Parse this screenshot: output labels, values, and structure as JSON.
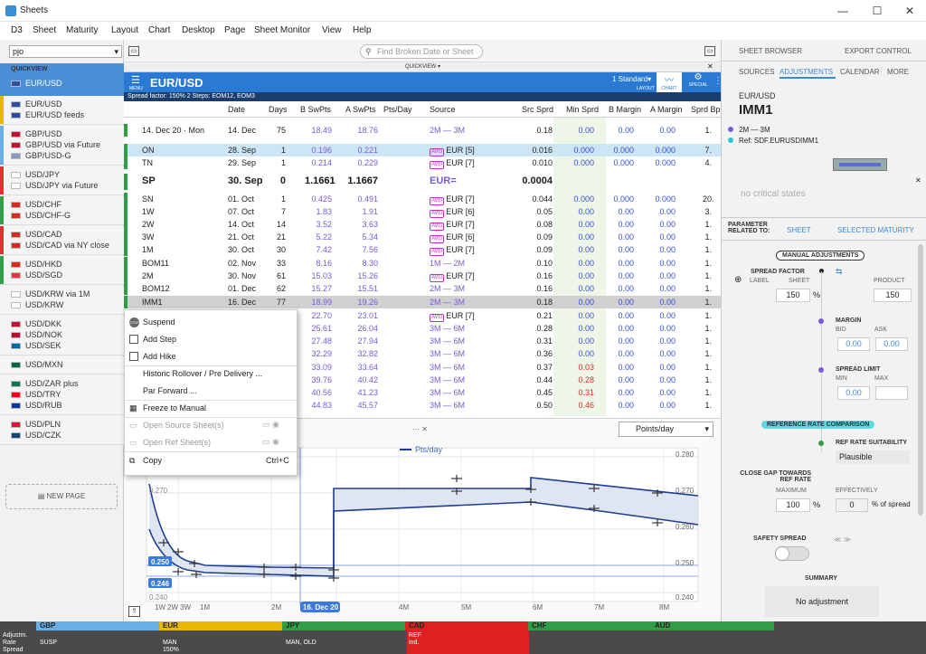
{
  "window": {
    "title": "Sheets"
  },
  "menu": [
    "D3",
    "Sheet",
    "Maturity",
    "Layout",
    "Chart",
    "Desktop",
    "Page",
    "Sheet Monitor",
    "View",
    "Help"
  ],
  "left": {
    "combo": "pjo",
    "quickview": "QUICKVIEW",
    "groups": [
      {
        "color": "#2f9e44",
        "items": [
          "EUR/USD"
        ]
      },
      {
        "color": "#e8b800",
        "items": [
          "EUR/USD",
          "EUR/USD feeds"
        ]
      },
      {
        "color": "#6aaee8",
        "items": [
          "GBP/USD",
          "GBP/USD via Future",
          "GBP/USD-G"
        ]
      },
      {
        "color": "#e03030",
        "items": [
          "USD/JPY",
          "USD/JPY via Future"
        ]
      },
      {
        "color": "#2f9e44",
        "items": [
          "USD/CHF",
          "USD/CHF-G"
        ]
      },
      {
        "color": "#e03030",
        "items": [
          "USD/CAD",
          "USD/CAD via NY close"
        ]
      },
      {
        "color": "#2f9e44",
        "items": [
          "USD/HKD",
          "USD/SGD"
        ]
      },
      {
        "color": "",
        "items": [
          "USD/KRW via 1M",
          "USD/KRW"
        ]
      },
      {
        "color": "",
        "items": [
          "USD/DKK",
          "USD/NOK",
          "USD/SEK"
        ]
      },
      {
        "color": "",
        "items": [
          "USD/MXN"
        ]
      },
      {
        "color": "",
        "items": [
          "USD/ZAR plus",
          "USD/TRY",
          "USD/RUB"
        ]
      },
      {
        "color": "",
        "items": [
          "USD/PLN",
          "USD/CZK"
        ]
      }
    ],
    "new_page": "NEW PAGE"
  },
  "toolbar": {
    "search_placeholder": "Find Broken Date or Sheet",
    "quickview": "QUICKVIEW"
  },
  "sheet": {
    "menu_label": "MENU",
    "title": "EUR/USD",
    "layout": "1 Standard",
    "layout_label": "LAYOUT",
    "chart_label": "CHART",
    "special_label": "SPECIAL",
    "subheader": "Spread factor: 150%   2 Steps: EOM12, EOM3",
    "columns": [
      "Date",
      "Days",
      "B SwPts",
      "A SwPts",
      "Pts/Day",
      "Source",
      "Src Sprd",
      "Min Sprd",
      "B Margin",
      "A Margin",
      "Sprd Bp"
    ],
    "spot_label": "14. Dec 20 · Mon",
    "rows": [
      {
        "name": "",
        "date": "14. Dec",
        "days": "75",
        "b": "18.49",
        "a": "18.76",
        "src": "2M — 3M",
        "sprd": "0.18",
        "min": "0.00",
        "bm": "0.00",
        "am": "0.00",
        "bp": "1."
      },
      {
        "name": "ON",
        "date": "28. Sep",
        "days": "1",
        "b": "0.196",
        "a": "0.221",
        "src": "EUR [5]",
        "sprd": "0.016",
        "min": "0.000",
        "bm": "0.000",
        "am": "0.000",
        "bp": "7."
      },
      {
        "name": "TN",
        "date": "29. Sep",
        "days": "1",
        "b": "0.214",
        "a": "0.229",
        "src": "EUR [7]",
        "sprd": "0.010",
        "min": "0.000",
        "bm": "0.000",
        "am": "0.000",
        "bp": "4."
      },
      {
        "name": "SP",
        "date": "30. Sep",
        "days": "0",
        "b": "1.1661",
        "a": "1.1667",
        "src": "EUR=",
        "sprd": "0.0004",
        "min": "",
        "bm": "",
        "am": "",
        "bp": ""
      },
      {
        "name": "SN",
        "date": "01. Oct",
        "days": "1",
        "b": "0.425",
        "a": "0.491",
        "src": "EUR [7]",
        "sprd": "0.044",
        "min": "0.000",
        "bm": "0.000",
        "am": "0.000",
        "bp": "20."
      },
      {
        "name": "1W",
        "date": "07. Oct",
        "days": "7",
        "b": "1.83",
        "a": "1.91",
        "src": "EUR [6]",
        "sprd": "0.05",
        "min": "0.00",
        "bm": "0.00",
        "am": "0.00",
        "bp": "3."
      },
      {
        "name": "2W",
        "date": "14. Oct",
        "days": "14",
        "b": "3.52",
        "a": "3.63",
        "src": "EUR [7]",
        "sprd": "0.08",
        "min": "0.00",
        "bm": "0.00",
        "am": "0.00",
        "bp": "1."
      },
      {
        "name": "3W",
        "date": "21. Oct",
        "days": "21",
        "b": "5.22",
        "a": "5.34",
        "src": "EUR [6]",
        "sprd": "0.09",
        "min": "0.00",
        "bm": "0.00",
        "am": "0.00",
        "bp": "1."
      },
      {
        "name": "1M",
        "date": "30. Oct",
        "days": "30",
        "b": "7.42",
        "a": "7.56",
        "src": "EUR [7]",
        "sprd": "0.09",
        "min": "0.00",
        "bm": "0.00",
        "am": "0.00",
        "bp": "1."
      },
      {
        "name": "BOM11",
        "date": "02. Nov",
        "days": "33",
        "b": "8.16",
        "a": "8.30",
        "src": "1M — 2M",
        "sprd": "0.10",
        "min": "0.00",
        "bm": "0.00",
        "am": "0.00",
        "bp": "1."
      },
      {
        "name": "2M",
        "date": "30. Nov",
        "days": "61",
        "b": "15.03",
        "a": "15.26",
        "src": "EUR [7]",
        "sprd": "0.16",
        "min": "0.00",
        "bm": "0.00",
        "am": "0.00",
        "bp": "1."
      },
      {
        "name": "BOM12",
        "date": "01. Dec",
        "days": "62",
        "b": "15.27",
        "a": "15.51",
        "src": "2M — 3M",
        "sprd": "0.16",
        "min": "0.00",
        "bm": "0.00",
        "am": "0.00",
        "bp": "1."
      },
      {
        "name": "IMM1",
        "date": "16. Dec",
        "days": "77",
        "b": "18.99",
        "a": "19.26",
        "src": "2M — 3M",
        "sprd": "0.18",
        "min": "0.00",
        "bm": "0.00",
        "am": "0.00",
        "bp": "1."
      },
      {
        "name": "",
        "date": "",
        "days": "",
        "b": "22.70",
        "a": "23.01",
        "src": "EUR [7]",
        "sprd": "0.21",
        "min": "0.00",
        "bm": "0.00",
        "am": "0.00",
        "bp": "1."
      },
      {
        "name": "",
        "date": "",
        "days": "",
        "b": "25.61",
        "a": "26.04",
        "src": "3M — 6M",
        "sprd": "0.28",
        "min": "0.00",
        "bm": "0.00",
        "am": "0.00",
        "bp": "1."
      },
      {
        "name": "",
        "date": "",
        "days": "",
        "b": "27.48",
        "a": "27.94",
        "src": "3M — 6M",
        "sprd": "0.31",
        "min": "0.00",
        "bm": "0.00",
        "am": "0.00",
        "bp": "1."
      },
      {
        "name": "",
        "date": "",
        "days": "",
        "b": "32.29",
        "a": "32.82",
        "src": "3M — 6M",
        "sprd": "0.36",
        "min": "0.00",
        "bm": "0.00",
        "am": "0.00",
        "bp": "1."
      },
      {
        "name": "",
        "date": "",
        "days": "",
        "b": "33.09",
        "a": "33.64",
        "src": "3M — 6M",
        "sprd": "0.37",
        "min": "0.03",
        "bm": "0.00",
        "am": "0.00",
        "bp": "1."
      },
      {
        "name": "",
        "date": "",
        "days": "",
        "b": "39.76",
        "a": "40.42",
        "src": "3M — 6M",
        "sprd": "0.44",
        "min": "0.28",
        "bm": "0.00",
        "am": "0.00",
        "bp": "1."
      },
      {
        "name": "",
        "date": "",
        "days": "",
        "b": "40.56",
        "a": "41.23",
        "src": "3M — 6M",
        "sprd": "0.45",
        "min": "0.31",
        "bm": "0.00",
        "am": "0.00",
        "bp": "1."
      },
      {
        "name": "",
        "date": "",
        "days": "",
        "b": "44.83",
        "a": "45.57",
        "src": "3M — 6M",
        "sprd": "0.50",
        "min": "0.46",
        "bm": "0.00",
        "am": "0.00",
        "bp": "1."
      }
    ]
  },
  "context_menu": [
    "Suspend",
    "Add Step",
    "Add Hike",
    "Historic Rollover / Pre Delivery ...",
    "Par Forward ...",
    "Freeze to Manual",
    "Open Source Sheet(s)",
    "Open Ref Sheet(s)",
    "Copy"
  ],
  "context_shortcut": "Ctrl+C",
  "chart": {
    "dropdown": "Points/day",
    "legend": "Pts/day",
    "y_ticks": [
      "0.280",
      "0.270",
      "0.260",
      "0.250",
      "0.240"
    ],
    "left_ticks": [
      "0.270",
      "0.240"
    ],
    "x_ticks": [
      "1W",
      "2W",
      "3W",
      "1M",
      "2M",
      "4M",
      "5M",
      "6M",
      "7M",
      "8M"
    ],
    "marker_top": "0.250",
    "marker_bottom": "0.246",
    "date_marker": "16. Dec 20"
  },
  "right": {
    "tabs1": [
      "SHEET BROWSER",
      "EXPORT CONTROL"
    ],
    "tabs2": [
      "SOURCES",
      "ADJUSTMENTS",
      "CALENDAR",
      "MORE"
    ],
    "pair": "EUR/USD",
    "maturity": "IMM1",
    "legend1": "2M — 3M",
    "legend2": "Ref: SDF.EURUSDIMM1",
    "no_states": "no critical states",
    "param_label": "PARAMETER RELATED TO:",
    "param_tabs": [
      "SHEET",
      "SELECTED MATURITY"
    ],
    "manual": "MANUAL ADJUSTMENTS",
    "spread_factor": "SPREAD FACTOR",
    "label": "LABEL",
    "sheet": "SHEET",
    "sf_value": "150",
    "product": "PRODUCT",
    "product_value": "150",
    "margin": "MARGIN",
    "bid": "BID",
    "ask": "ASK",
    "bid_value": "0.00",
    "ask_value": "0.00",
    "spread_limit": "SPREAD LIMIT",
    "min": "MIN",
    "max": "MAX",
    "min_value": "0.00",
    "ref": "REFERENCE RATE COMPARISON",
    "suit": "REF RATE SUITABILITY",
    "suit_value": "Plausible",
    "close_gap": "CLOSE GAP TOWARDS REF RATE",
    "maximum": "MAXIMUM",
    "max_value": "100",
    "effectively": "EFFECTIVELY",
    "eff_value": "0",
    "of_spread": "% of spread",
    "safety": "SAFETY SPREAD",
    "summary": "SUMMARY",
    "no_adj": "No adjustment",
    "percent": "%"
  },
  "bottom": {
    "labels": [
      "Adjustm.",
      "Rate",
      "Spread"
    ],
    "susp": "SUSP",
    "ccys": [
      {
        "name": "GBP",
        "color": "#6aaee8"
      },
      {
        "name": "EUR",
        "color": "#e8b800"
      },
      {
        "name": "JPY",
        "color": "#2f9e44"
      },
      {
        "name": "CAD",
        "color": "#e02020"
      },
      {
        "name": "CHF",
        "color": "#2f9e44"
      },
      {
        "name": "AUD",
        "color": "#2f9e44"
      }
    ],
    "eur_info": [
      "MAN",
      "150%"
    ],
    "jpy_info": "MAN, OLD",
    "cad_info": [
      "REF",
      "ind."
    ]
  }
}
